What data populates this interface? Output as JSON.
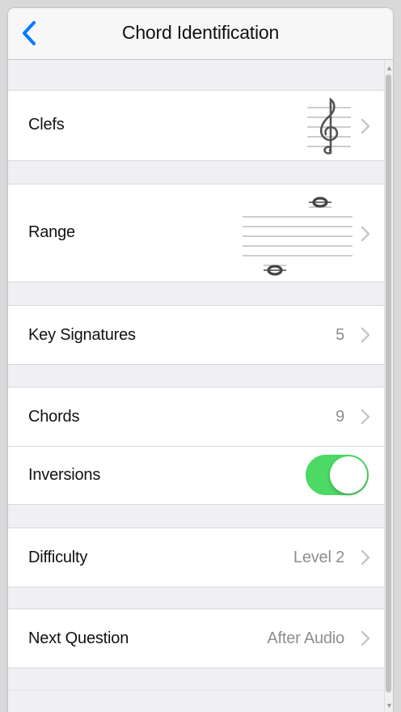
{
  "navbar": {
    "title": "Chord Identification"
  },
  "rows": {
    "clefs": {
      "label": "Clefs"
    },
    "range": {
      "label": "Range"
    },
    "key_signatures": {
      "label": "Key Signatures",
      "value": "5"
    },
    "chords": {
      "label": "Chords",
      "value": "9"
    },
    "inversions": {
      "label": "Inversions",
      "toggle_on": true
    },
    "difficulty": {
      "label": "Difficulty",
      "value": "Level 2"
    },
    "next_question": {
      "label": "Next Question",
      "value": "After Audio"
    }
  },
  "colors": {
    "accent_blue": "#007aff",
    "toggle_green": "#4cd964",
    "chevron_gray": "#c7c7cc",
    "value_gray": "#8e8e93"
  },
  "icons": {
    "back": "chevron-left-icon",
    "disclosure": "chevron-right-icon",
    "clef": "treble-clef-icon",
    "range": "staff-range-icon"
  }
}
